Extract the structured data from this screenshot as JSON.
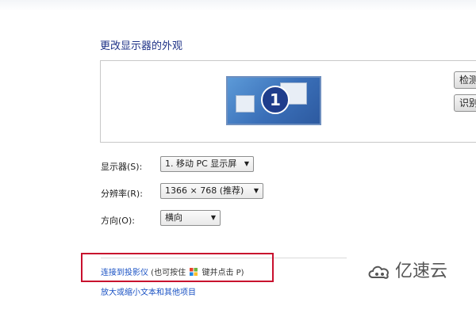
{
  "heading": "更改显示器的外观",
  "preview": {
    "monitor_number": "1"
  },
  "side_buttons": [
    {
      "label": "检测"
    },
    {
      "label": "识别"
    }
  ],
  "settings": {
    "display_label": "显示器(S):",
    "display_value": "1. 移动 PC 显示屏",
    "resolution_label": "分辨率(R):",
    "resolution_value": "1366 × 768 (推荐)",
    "orientation_label": "方向(O):",
    "orientation_value": "横向"
  },
  "links": {
    "projector_link": "连接到投影仪",
    "projector_hint_prefix": " (也可按住 ",
    "projector_hint_suffix": " 键并点击 P)",
    "text_size_link": "放大或缩小文本和其他项目"
  },
  "watermark": {
    "text": "亿速云"
  },
  "colors": {
    "link": "#1a52c4",
    "heading": "#1e3287",
    "highlight_border": "#c8102e",
    "monitor_blue": "#3a6fb8"
  },
  "icons": {
    "windows_key": "windows-logo-icon",
    "dropdown": "chevron-down-icon",
    "watermark_logo": "cloud-logo-icon"
  }
}
